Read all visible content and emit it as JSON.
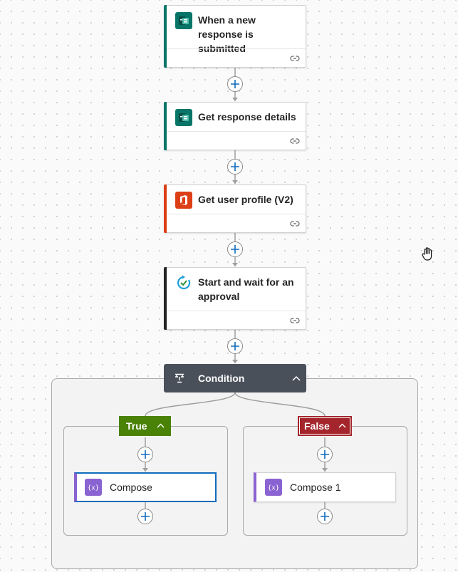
{
  "flow": {
    "trigger": {
      "title": "When a new response is submitted",
      "icon": "forms-icon",
      "accent": "#077568"
    },
    "steps": [
      {
        "title": "Get response details",
        "icon": "forms-icon",
        "accent": "#077568"
      },
      {
        "title": "Get user profile (V2)",
        "icon": "office365-icon",
        "accent": "#dc3e15"
      },
      {
        "title": "Start and wait for an approval",
        "icon": "approvals-icon",
        "accent": "#242424"
      }
    ],
    "condition": {
      "title": "Condition",
      "header_color": "#4a505a",
      "true_branch": {
        "label": "True",
        "color": "#498205",
        "action": {
          "title": "Compose",
          "icon": "compose-icon"
        }
      },
      "false_branch": {
        "label": "False",
        "color": "#a4262c",
        "action": {
          "title": "Compose 1",
          "icon": "compose-icon"
        }
      }
    }
  },
  "colors": {
    "add_accent": "#0f6cbd",
    "compose_accent": "#8a63d2",
    "selected_border": "#0f6cbd"
  }
}
